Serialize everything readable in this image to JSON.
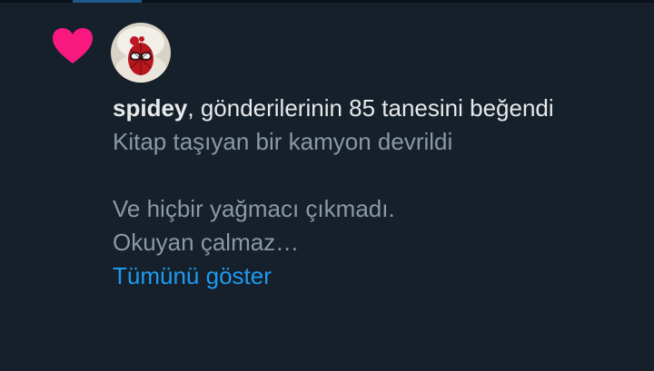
{
  "notification": {
    "icon": "heart-icon",
    "icon_color": "#f91880",
    "avatar": "spiderman-avatar",
    "username": "spidey",
    "action_text": ", gönderilerinin 85 tanesini beğendi",
    "tweet_lines": [
      "Kitap taşıyan bir kamyon devrildi",
      "",
      "Ve hiçbir yağmacı çıkmadı.",
      "Okuyan çalmaz…"
    ],
    "show_more_label": "Tümünü göster",
    "link_color": "#1d9bf0"
  }
}
